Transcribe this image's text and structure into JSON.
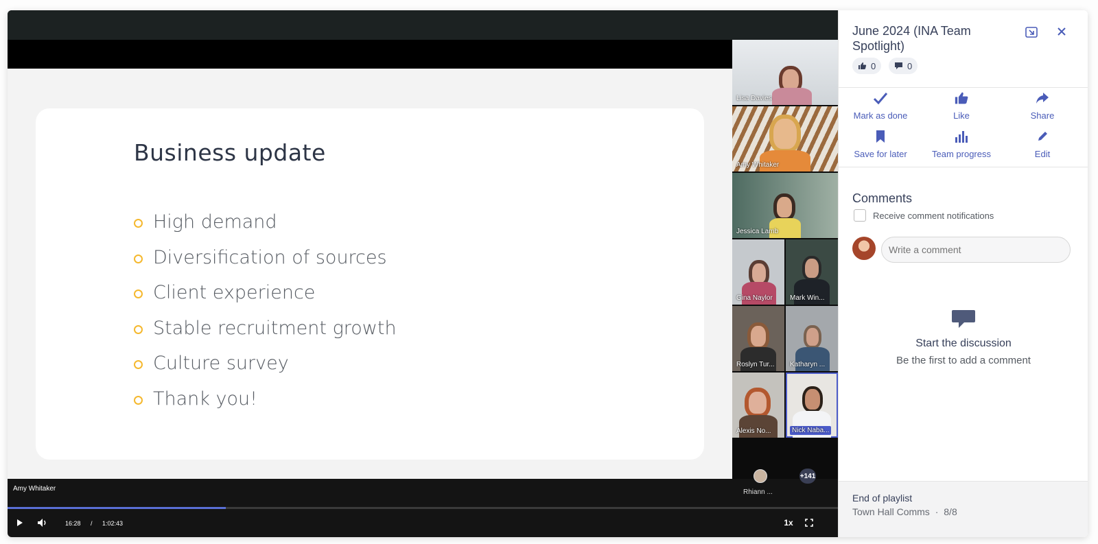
{
  "slide": {
    "title": "Business update",
    "bullets": [
      "High demand",
      "Diversification of sources",
      "Client experience",
      "Stable recruitment growth",
      "Culture survey",
      "Thank you!"
    ],
    "bullet_color": "#f5b82e"
  },
  "participants": {
    "lisa": "Lisa Davies",
    "amy": "Amy Whitaker",
    "jessica": "Jessica Lamb",
    "gina": "Gina Naylor",
    "mark": "Mark Win...",
    "roslyn": "Roslyn Tur...",
    "katharyn": "Katharyn ...",
    "alexis": "Alexis No...",
    "nick": "Nick Naba...",
    "rhiann": "Rhiann ...",
    "more_count": "+141"
  },
  "player": {
    "speaker": "Amy Whitaker",
    "current_time": "16:28",
    "separator": "/",
    "duration": "1:02:43",
    "progress_percent": 26.3,
    "speed": "1x"
  },
  "panel": {
    "title": "June 2024 (INA Team Spotlight)",
    "likes_count": "0",
    "comments_count": "0",
    "actions": {
      "mark_done": "Mark as done",
      "like": "Like",
      "share": "Share",
      "save_later": "Save for later",
      "team_progress": "Team progress",
      "edit": "Edit"
    },
    "comments_heading": "Comments",
    "notify_label": "Receive comment notifications",
    "comment_placeholder": "Write a comment",
    "empty_title": "Start the discussion",
    "empty_sub": "Be the first to add a comment",
    "footer_title": "End of playlist",
    "footer_playlist": "Town Hall Comms",
    "footer_dot": "·",
    "footer_position": "8/8",
    "accent": "#4a5cb8"
  }
}
